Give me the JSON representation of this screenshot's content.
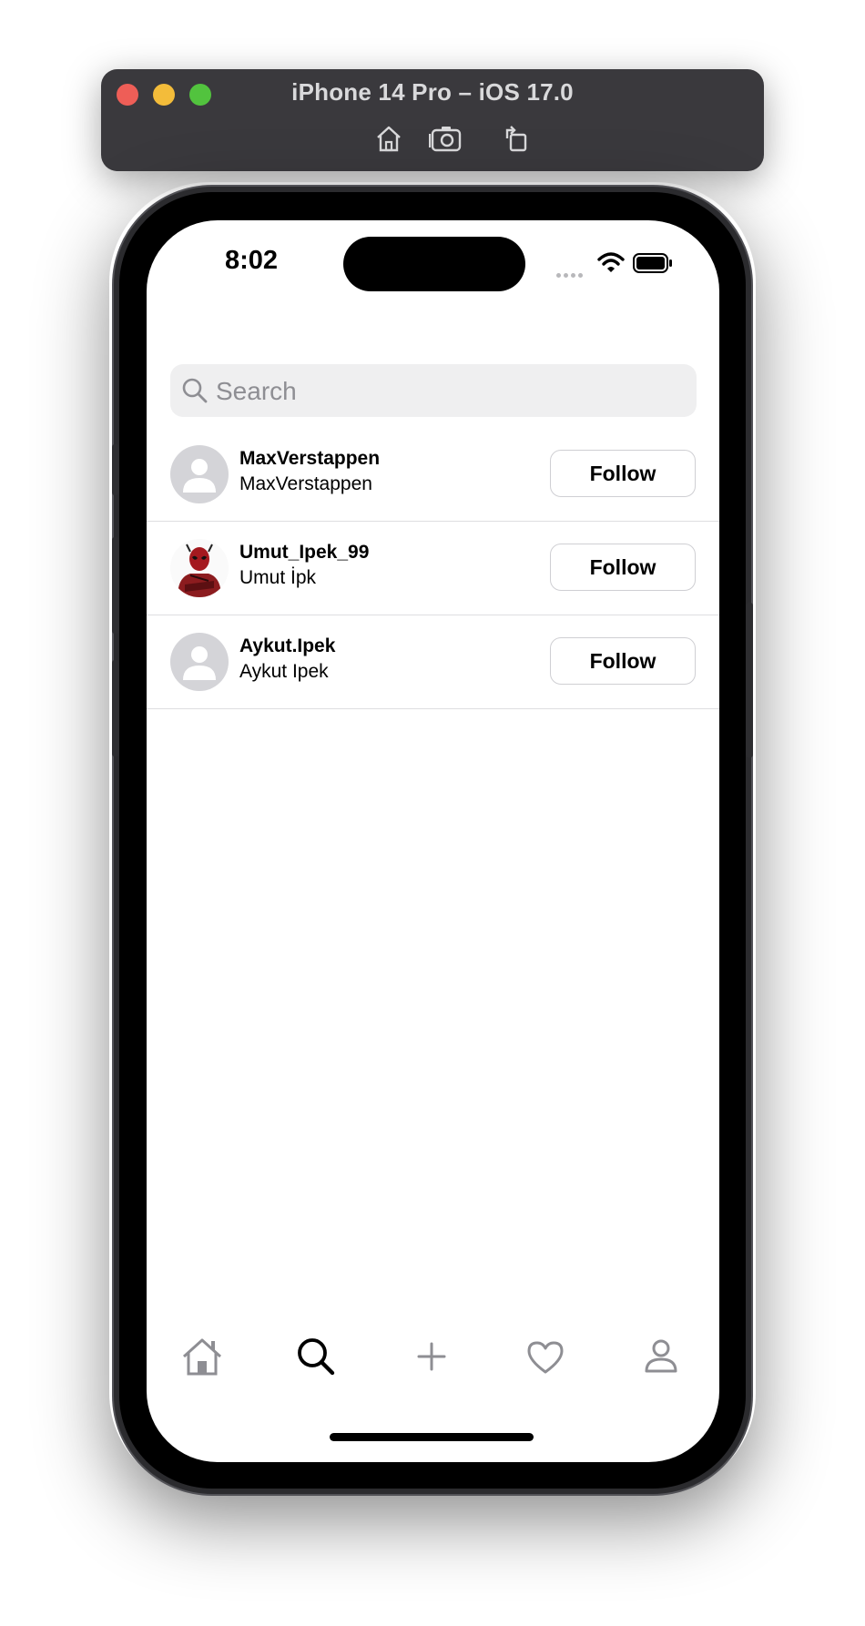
{
  "simulator": {
    "title": "iPhone 14 Pro – iOS 17.0",
    "toolbar": [
      {
        "name": "home-icon"
      },
      {
        "name": "screenshot-icon"
      },
      {
        "name": "rotate-icon"
      }
    ]
  },
  "status_bar": {
    "time": "8:02"
  },
  "search": {
    "placeholder": "Search",
    "value": ""
  },
  "users": [
    {
      "username": "MaxVerstappen",
      "full_name": "MaxVerstappen",
      "avatar": "default-avatar-icon",
      "button_label": "Follow"
    },
    {
      "username": "Umut_Ipek_99",
      "full_name": "Umut İpk",
      "avatar": "deadpool-photo",
      "button_label": "Follow"
    },
    {
      "username": "Aykut.Ipek",
      "full_name": "Aykut Ipek",
      "avatar": "default-avatar-icon",
      "button_label": "Follow"
    }
  ],
  "tab_bar": {
    "tabs": [
      {
        "name": "home-icon",
        "selected": false
      },
      {
        "name": "search-icon",
        "selected": true
      },
      {
        "name": "plus-icon",
        "selected": false
      },
      {
        "name": "heart-icon",
        "selected": false
      },
      {
        "name": "profile-icon",
        "selected": false
      }
    ]
  },
  "colors": {
    "titlebar_bg": "#3a393d",
    "search_bg": "#efeff0",
    "placeholder": "#8e8e93",
    "tab_inactive": "#8e8e93",
    "tab_active": "#000000",
    "avatar_bg": "#d4d4d8"
  }
}
